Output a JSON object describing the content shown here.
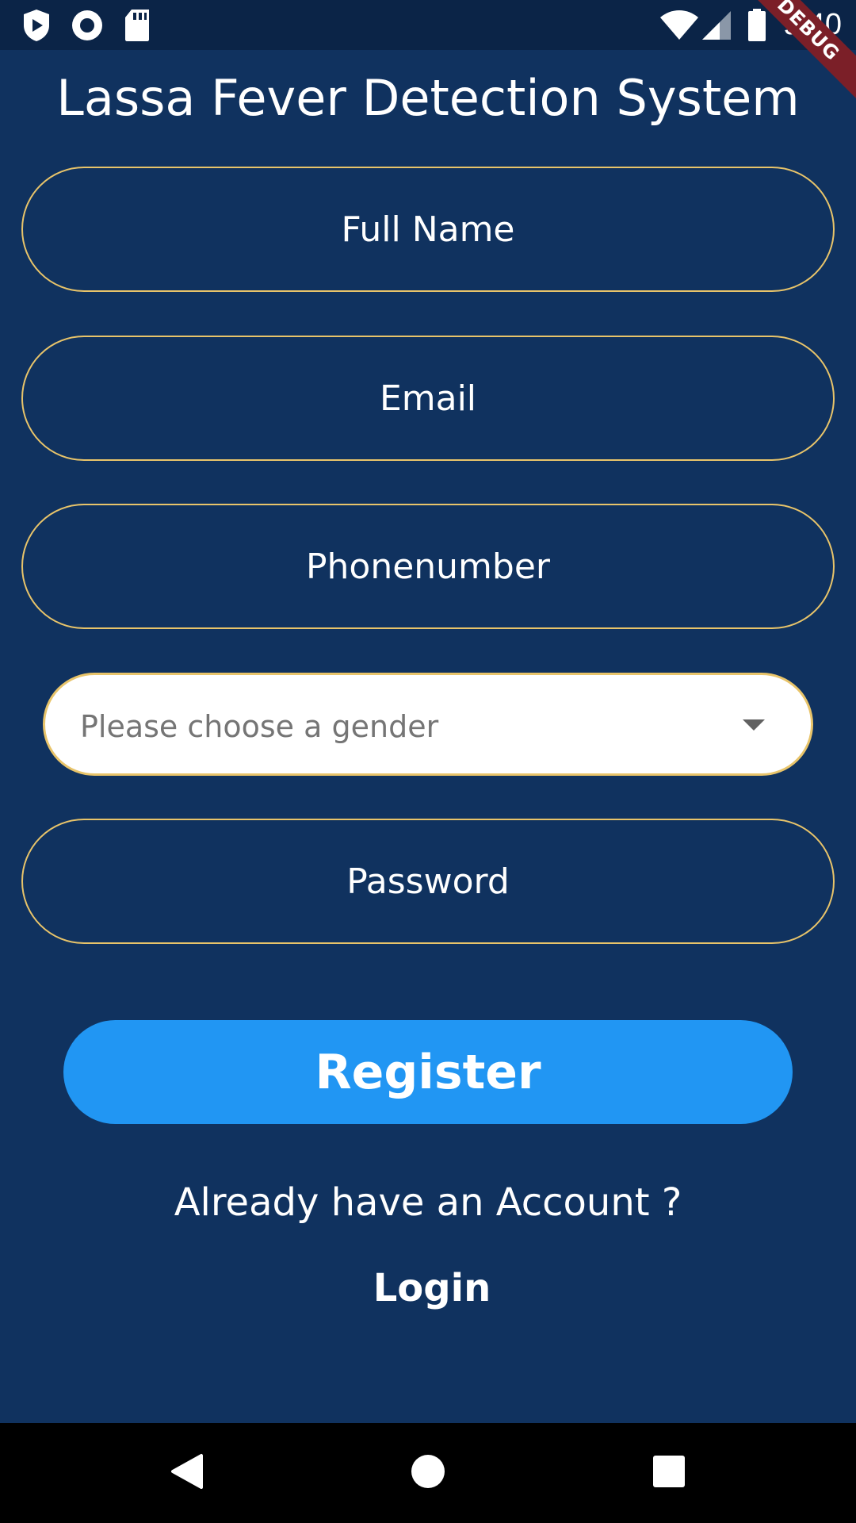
{
  "status_bar": {
    "time": "9:40",
    "left_icons": [
      "play-protect-icon",
      "record-icon",
      "sd-card-icon"
    ],
    "right_icons": [
      "wifi-icon",
      "cell-signal-icon",
      "battery-icon"
    ],
    "debug_banner": "DEBUG"
  },
  "title": "Lassa Fever Detection System",
  "form": {
    "full_name_placeholder": "Full Name",
    "email_placeholder": "Email",
    "phone_placeholder": "Phonenumber",
    "gender_placeholder": "Please choose a gender",
    "password_placeholder": "Password"
  },
  "register_label": "Register",
  "account_prompt": "Already have an Account ?",
  "login_label": "Login",
  "nav_bar": {
    "buttons": [
      "back-icon",
      "home-icon",
      "recents-icon"
    ]
  },
  "colors": {
    "background": "#10325f",
    "status_bar": "#0b2447",
    "field_border": "#e8c46a",
    "register_button": "#2196f3",
    "debug_ribbon": "#7b1f28",
    "nav_bar": "#000000"
  }
}
